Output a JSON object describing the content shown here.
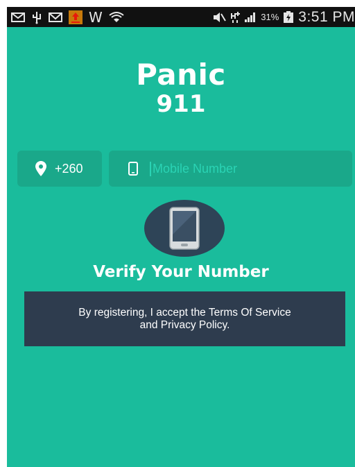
{
  "status_bar": {
    "icons_left": [
      "email-icon",
      "usb-icon",
      "gmail-icon",
      "upload-notification-icon",
      "w-icon",
      "wifi-icon"
    ],
    "w_glyph": "W",
    "icons_right": [
      "mute-icon",
      "hplus-icon",
      "signal-icon",
      "battery-charging-icon"
    ],
    "battery": "31%",
    "time": "3:51 PM"
  },
  "header": {
    "title_line1": "Panic",
    "title_line2": "911"
  },
  "form": {
    "country_code": "+260",
    "phone_placeholder": "Mobile Number",
    "phone_value": ""
  },
  "verify": {
    "label": "Verify Your Number"
  },
  "terms": {
    "line1": "By registering, I accept the Terms Of Service",
    "line2": "and Privacy Policy."
  },
  "colors": {
    "background": "#1abc9c",
    "field_bg": "#1aa88a",
    "dark": "#2e3c4e",
    "circle": "#2e4457",
    "status_bar": "#111111"
  }
}
